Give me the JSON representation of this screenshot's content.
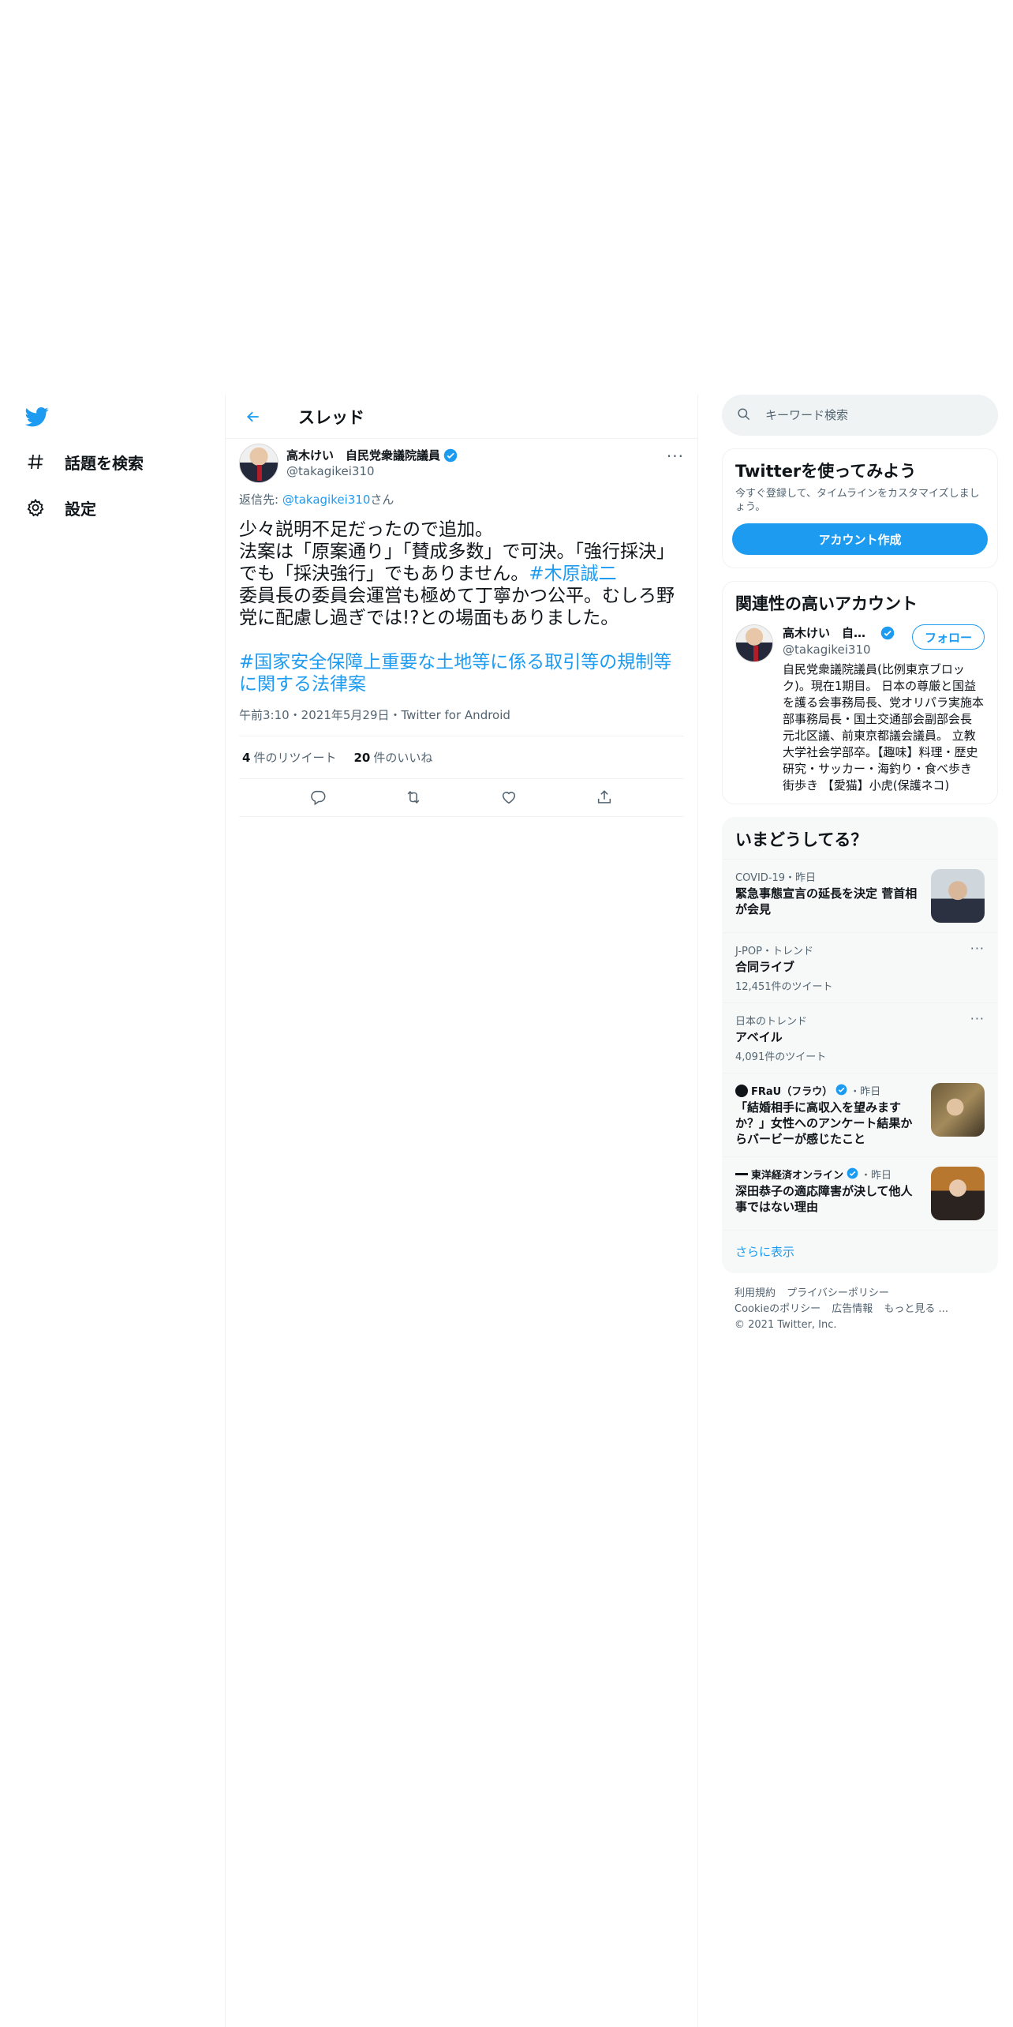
{
  "nav": {
    "explore_label": "話題を検索",
    "settings_label": "設定"
  },
  "header": {
    "title": "スレッド"
  },
  "tweet": {
    "author_name": "高木けい　自民党衆議院議員",
    "author_handle": "@takagikei310",
    "reply_to_prefix": "返信先: ",
    "reply_to_handle": "@takagikei310",
    "reply_to_suffix": "さん",
    "text_line1": "少々説明不足だったので追加。",
    "text_line2": "法案は「原案通り」「賛成多数」で可決。「強行採決」でも「採決強行」でもありません。",
    "hashtag1": "#木原誠二",
    "text_line3": "委員長の委員会運営も極めて丁寧かつ公平。むしろ野党に配慮し過ぎでは!?との場面もありました。",
    "hashtag2": "#国家安全保障上重要な土地等に係る取引等の規制等に関する法律案",
    "timestamp": "午前3:10・2021年5月29日・Twitter for Android",
    "retweet_count": "4",
    "retweet_label": "件のリツイート",
    "like_count": "20",
    "like_label": "件のいいね"
  },
  "search": {
    "placeholder": "キーワード検索"
  },
  "signup": {
    "title": "Twitterを使ってみよう",
    "subtitle": "今すぐ登録して、タイムラインをカスタマイズしましょう。",
    "button": "アカウント作成"
  },
  "related": {
    "title": "関連性の高いアカウント",
    "name": "高木けい　自民党衆議院議員",
    "handle": "@takagikei310",
    "follow_label": "フォロー",
    "bio": "自民党衆議院議員(比例東京ブロック)。現在1期目。 日本の尊厳と国益を護る会事務局長、党オリパラ実施本部事務局長・国土交通部会副部会長 元北区議、前東京都議会議員。 立教大学社会学部卒。【趣味】料理・歴史研究・サッカー・海釣り・食べ歩き 街歩き 【愛猫】小虎(保護ネコ)"
  },
  "trends": {
    "title": "いまどうしてる？",
    "items": [
      {
        "context": "COVID-19・昨日",
        "title": "緊急事態宣言の延長を決定 菅首相が会見",
        "count": ""
      },
      {
        "context": "J-POP・トレンド",
        "title": "合同ライブ",
        "count": "12,451件のツイート"
      },
      {
        "context": "日本のトレンド",
        "title": "アベイル",
        "count": "4,091件のツイート"
      },
      {
        "context": "FRaU（フラウ）",
        "context_suffix": "・昨日",
        "title": "「結婚相手に高収入を望みますか？」女性へのアンケート結果からバービーが感じたこと",
        "count": ""
      },
      {
        "context": "東洋経済オンライン",
        "context_suffix": "・昨日",
        "title": "深田恭子の適応障害が決して他人事ではない理由",
        "count": ""
      }
    ],
    "show_more": "さらに表示"
  },
  "footer": {
    "terms": "利用規約",
    "privacy": "プライバシーポリシー",
    "cookie": "Cookieのポリシー",
    "ads": "広告情報",
    "more": "もっと見る ...",
    "copyright": "© 2021 Twitter, Inc."
  },
  "colors": {
    "accent": "#1d9bf0",
    "text": "#0f1419",
    "secondary": "#536471",
    "border": "#eff3f4"
  },
  "icons": [
    "twitter-logo-icon",
    "hashtag-icon",
    "gear-icon",
    "back-arrow-icon",
    "verified-badge-icon",
    "more-icon",
    "search-icon",
    "reply-icon",
    "retweet-icon",
    "like-icon",
    "share-icon"
  ]
}
